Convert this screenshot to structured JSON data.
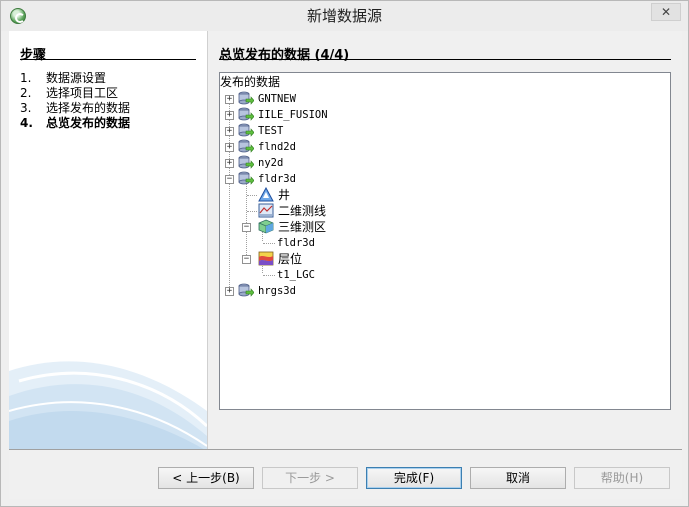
{
  "window": {
    "title": "新增数据源",
    "close_glyph": "✕"
  },
  "steps": {
    "header": "步骤",
    "items": [
      {
        "num": "1.",
        "label": "数据源设置"
      },
      {
        "num": "2.",
        "label": "选择项目工区"
      },
      {
        "num": "3.",
        "label": "选择发布的数据"
      },
      {
        "num": "4.",
        "label": "总览发布的数据",
        "current": true
      }
    ]
  },
  "content": {
    "header": "总览发布的数据 (4/4)",
    "tree_root": "发布的数据",
    "nodes": [
      {
        "label": "GNTNEW",
        "toggle": "+"
      },
      {
        "label": "IILE_FUSION",
        "toggle": "+"
      },
      {
        "label": "TEST",
        "toggle": "+"
      },
      {
        "label": "flnd2d",
        "toggle": "+"
      },
      {
        "label": "ny2d",
        "toggle": "+"
      },
      {
        "label": "fldr3d",
        "toggle": "−"
      },
      {
        "label": "井"
      },
      {
        "label": "二维测线"
      },
      {
        "label": "三维测区",
        "toggle": "−"
      },
      {
        "label": "fldr3d"
      },
      {
        "label": "层位",
        "toggle": "−"
      },
      {
        "label": "t1_LGC"
      },
      {
        "label": "hrgs3d",
        "toggle": "+"
      }
    ]
  },
  "buttons": {
    "back": "< 上一步(B)",
    "next": "下一步 >",
    "finish": "完成(F)",
    "cancel": "取消",
    "help": "帮助(H)"
  },
  "icons": {
    "app": "app-globe-icon",
    "project": "project-database-icon",
    "well": "well-triangle-icon",
    "line2d": "seismic-2d-line-icon",
    "survey3d": "seismic-3d-cube-icon",
    "horizon": "horizon-layer-icon"
  }
}
